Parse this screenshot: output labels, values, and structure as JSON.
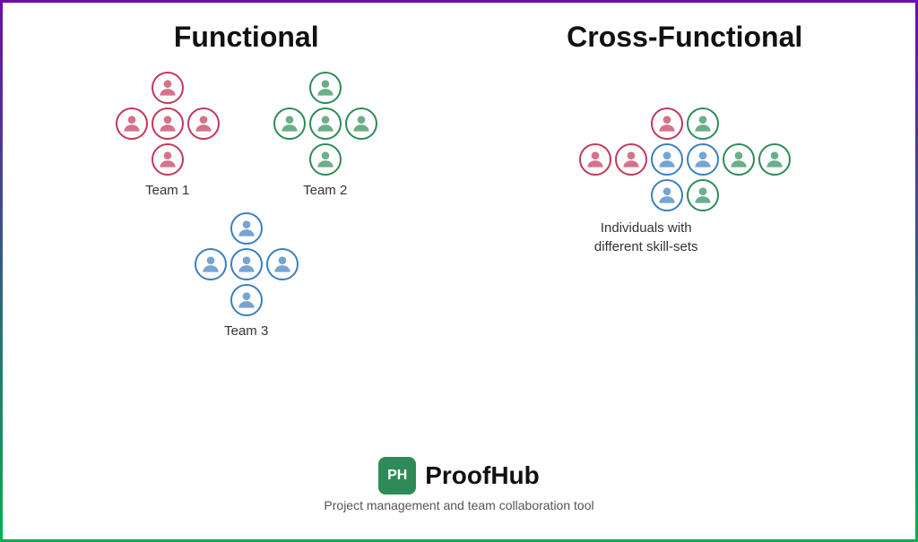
{
  "functional": {
    "title": "Functional",
    "team1": {
      "label": "Team 1",
      "color": "pink"
    },
    "team2": {
      "label": "Team 2",
      "color": "green"
    },
    "team3": {
      "label": "Team 3",
      "color": "blue"
    }
  },
  "crossFunctional": {
    "title": "Cross-Functional",
    "label": "Individuals with\ndifferent skill-sets"
  },
  "brand": {
    "logo": "PH",
    "name": "ProofHub",
    "tagline": "Project management and team collaboration tool"
  },
  "colors": {
    "pink": "#c0395a",
    "green": "#2e8b57",
    "blue": "#3a7fc1"
  }
}
